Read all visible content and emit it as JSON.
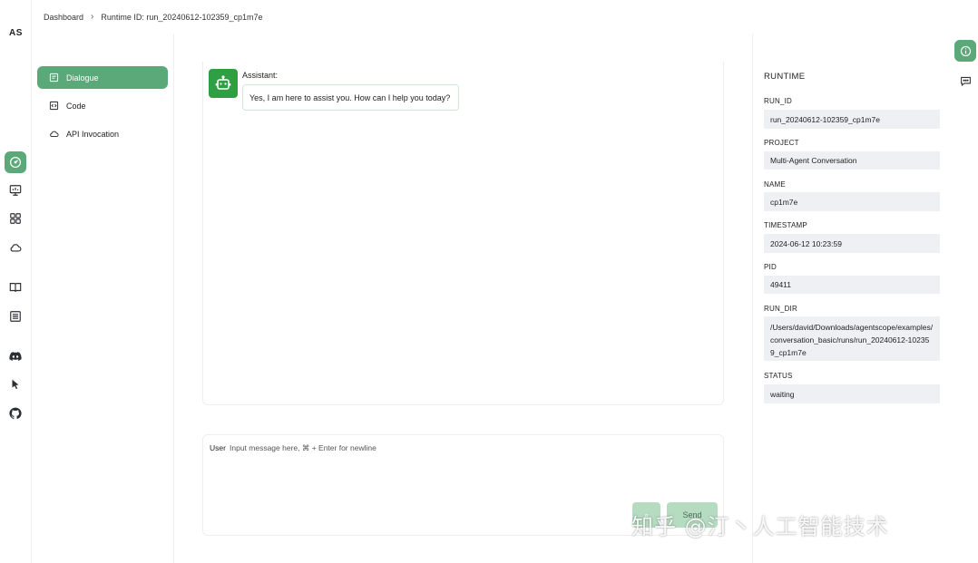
{
  "rail": {
    "logo": "AS",
    "icons": [
      "dashboard-icon",
      "monitor-icon",
      "grid-icon",
      "cloud-icon",
      "book-icon",
      "list-icon",
      "discord-icon",
      "cursor-icon",
      "github-icon"
    ]
  },
  "header": {
    "crumb_home": "Dashboard",
    "crumb_current": "Runtime ID: run_20240612-102359_cp1m7e"
  },
  "nav": {
    "items": [
      {
        "label": "Dialogue",
        "icon": "dialogue-icon",
        "active": true
      },
      {
        "label": "Code",
        "icon": "code-icon",
        "active": false
      },
      {
        "label": "API Invocation",
        "icon": "cloud-icon",
        "active": false
      }
    ]
  },
  "chat": {
    "sender": "Assistant:",
    "message": "Yes, I am here to assist you. How can I help you today?"
  },
  "composer": {
    "user_label": "User",
    "placeholder": "Input message here, ⌘ + Enter for newline",
    "send_label": "Send"
  },
  "runtime": {
    "title": "RUNTIME",
    "fields": [
      {
        "label": "RUN_ID",
        "value": "run_20240612-102359_cp1m7e"
      },
      {
        "label": "PROJECT",
        "value": "Multi-Agent Conversation"
      },
      {
        "label": "NAME",
        "value": "cp1m7e"
      },
      {
        "label": "TIMESTAMP",
        "value": "2024-06-12 10:23:59"
      },
      {
        "label": "PID",
        "value": "49411"
      },
      {
        "label": "RUN_DIR",
        "value": "/Users/david/Downloads/agentscope/examples/conversation_basic/runs/run_20240612-102359_cp1m7e"
      },
      {
        "label": "STATUS",
        "value": "waiting"
      }
    ]
  },
  "watermark": "知乎 @汀丶人工智能技术",
  "colors": {
    "accent": "#5ba879",
    "avatar": "#2ea043",
    "field_bg": "#eff0f3"
  }
}
